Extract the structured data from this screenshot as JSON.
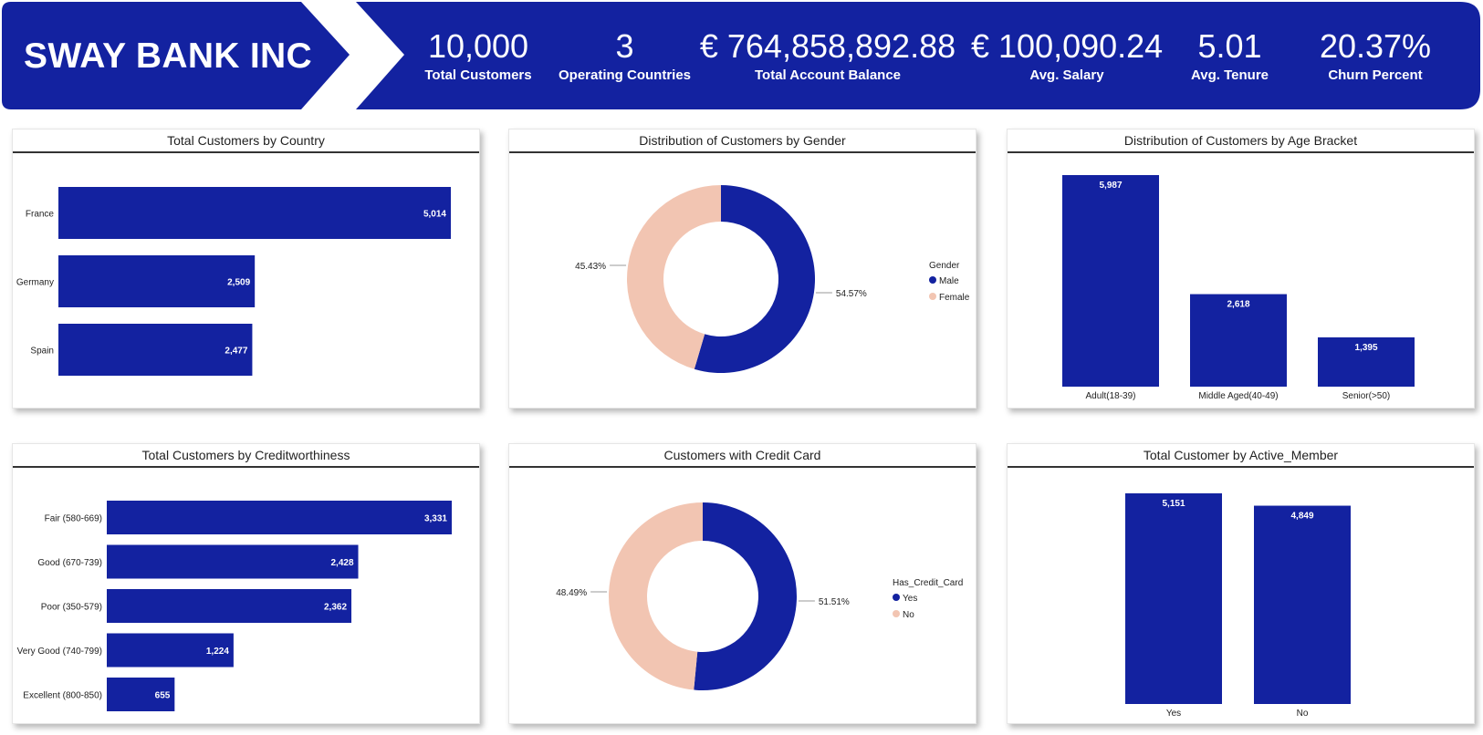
{
  "colors": {
    "navy": "#1322A0",
    "peach": "#F2C5B2",
    "text": "#222222"
  },
  "header": {
    "brand": "SWAY BANK INC",
    "kpis": [
      {
        "value": "10,000",
        "label": "Total Customers"
      },
      {
        "value": "3",
        "label": "Operating Countries"
      },
      {
        "value": "€ 764,858,892.88",
        "label": "Total Account Balance"
      },
      {
        "value": "€ 100,090.24",
        "label": "Avg. Salary"
      },
      {
        "value": "5.01",
        "label": "Avg. Tenure"
      },
      {
        "value": "20.37%",
        "label": "Churn Percent"
      }
    ]
  },
  "chart_data": [
    {
      "type": "bar",
      "orientation": "horizontal",
      "title": "Total Customers by Country",
      "categories": [
        "France",
        "Germany",
        "Spain"
      ],
      "values": [
        5014,
        2509,
        2477
      ],
      "value_labels": [
        "5,014",
        "2,509",
        "2,477"
      ]
    },
    {
      "type": "pie",
      "variant": "donut",
      "title": "Distribution of Customers by Gender",
      "legend_title": "Gender",
      "legend_position": "right",
      "slices": [
        {
          "label": "Male",
          "value": 54.57,
          "text": "54.57%",
          "color": "#1322A0"
        },
        {
          "label": "Female",
          "value": 45.43,
          "text": "45.43%",
          "color": "#F2C5B2"
        }
      ]
    },
    {
      "type": "bar",
      "orientation": "vertical",
      "title": "Distribution of Customers by Age Bracket",
      "categories": [
        "Adult(18-39)",
        "Middle Aged(40-49)",
        "Senior(>50)"
      ],
      "values": [
        5987,
        2618,
        1395
      ],
      "value_labels": [
        "5,987",
        "2,618",
        "1,395"
      ]
    },
    {
      "type": "bar",
      "orientation": "horizontal",
      "title": "Total Customers by Creditworthiness",
      "categories": [
        "Fair (580-669)",
        "Good (670-739)",
        "Poor (350-579)",
        "Very Good (740-799)",
        "Excellent (800-850)"
      ],
      "values": [
        3331,
        2428,
        2362,
        1224,
        655
      ],
      "value_labels": [
        "3,331",
        "2,428",
        "2,362",
        "1,224",
        "655"
      ]
    },
    {
      "type": "pie",
      "variant": "donut",
      "title": "Customers with Credit Card",
      "legend_title": "Has_Credit_Card",
      "legend_position": "right",
      "slices": [
        {
          "label": "Yes",
          "value": 51.51,
          "text": "51.51%",
          "color": "#1322A0"
        },
        {
          "label": "No",
          "value": 48.49,
          "text": "48.49%",
          "color": "#F2C5B2"
        }
      ]
    },
    {
      "type": "bar",
      "orientation": "vertical",
      "title": "Total Customer by Active_Member",
      "categories": [
        "Yes",
        "No"
      ],
      "values": [
        5151,
        4849
      ],
      "value_labels": [
        "5,151",
        "4,849"
      ]
    }
  ]
}
